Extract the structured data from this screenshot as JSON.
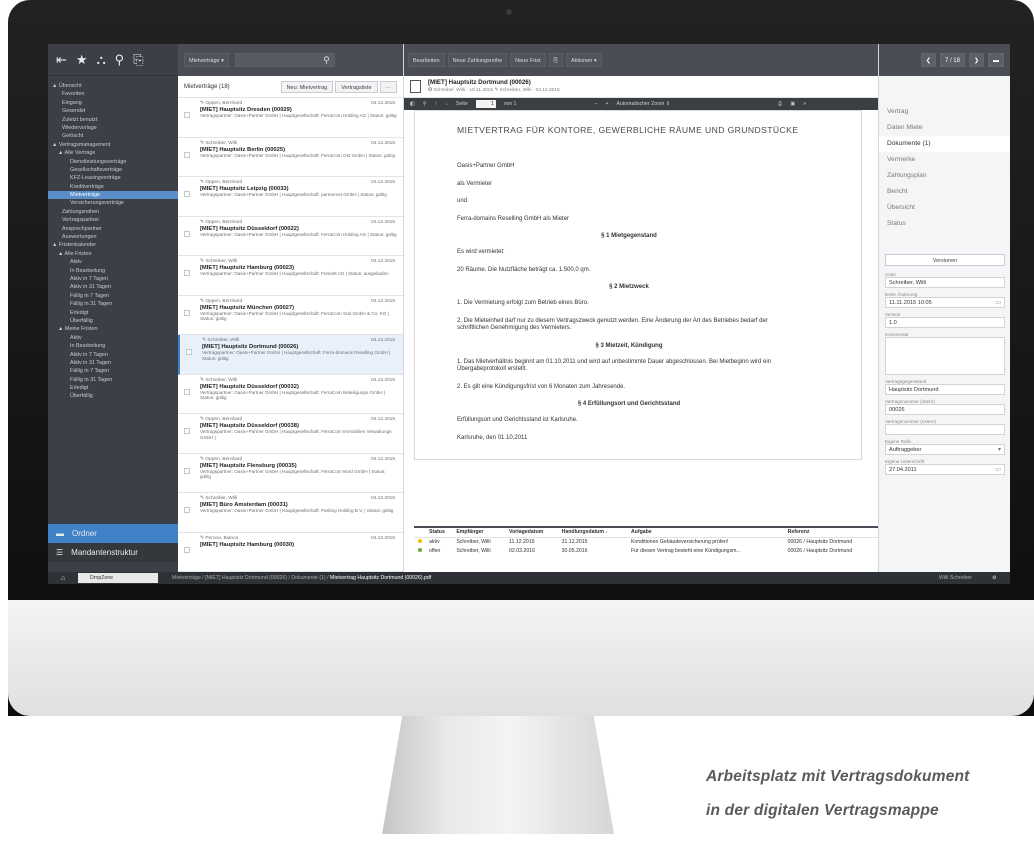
{
  "nav": {
    "tree": [
      "▲ Übersicht",
      "Favoriten",
      "Eingang",
      "Gesendet",
      "Zuletzt benutzt",
      "Wiedervorlage",
      "Gelöscht",
      "▲ Vertragsmanagement",
      "▲ Alle Verträge",
      "Dienstleistungsverträge",
      "Gesellschaftsverträge",
      "KFZ-Leasingverträge",
      "Kreditverträge",
      "Mietverträge",
      "Versicherungsverträge",
      "Zahlungsreihen",
      "Vertragspartner",
      "Ansprechpartner",
      "Auswertungen",
      "▲ Fristenkalender",
      "▲ Alle Fristen",
      "Aktiv",
      "In Bearbeitung",
      "Aktiv in 7 Tagen",
      "Aktiv in 31 Tagen",
      "Fällig in 7 Tagen",
      "Fällig in 31 Tagen",
      "Erledigt",
      "Überfällig",
      "▲ Meine Fristen",
      "Aktiv",
      "In Bearbeitung",
      "Aktiv in 7 Tagen",
      "Aktiv in 31 Tagen",
      "Fällig in 7 Tagen",
      "Fällig in 31 Tagen",
      "Erledigt",
      "Überfällig"
    ],
    "selected_index": 13,
    "ordner": "Ordner",
    "mandant": "Mandantenstruktur"
  },
  "list": {
    "dropdown": "Mietverträge ▾",
    "title": "Mietverträge (18)",
    "new_btn": "Neu: Mietvertrag",
    "list_btn": "Vertragsliste",
    "more_btn": "···",
    "items": [
      {
        "author": "✎ Oppen, Bernhard",
        "date": "04.12.2015",
        "title": "[MIET] Hauptsitz Dresden (00029)",
        "desc": "Vertragspartner: Oasis+Partner GmbH | Hauptgesellschaft: FerraCom Holding AG | Status: gültig"
      },
      {
        "author": "✎ Schreiber, Willi",
        "date": "04.12.2015",
        "title": "[MIET] Hauptsitz Berlin (00025)",
        "desc": "Vertragspartner: Oasis+Partner GmbH | Hauptgesellschaft: FerraCom Ost GmbH | Status: gültig"
      },
      {
        "author": "✎ Oppen, Bernhard",
        "date": "04.12.2015",
        "title": "[MIET] Hauptsitz Leipzig (00033)",
        "desc": "Vertragspartner: Oasis+Partner GmbH | Hauptgesellschaft: partnernet GmbH | Status: gültig"
      },
      {
        "author": "✎ Oppen, Bernhard",
        "date": "04.12.2015",
        "title": "[MIET] Hauptsitz Düsseldorf (00022)",
        "desc": "Vertragspartner: Oasis+Partner GmbH | Hauptgesellschaft: FerraCom Holding AG | Status: gültig"
      },
      {
        "author": "✎ Schreiber, Willi",
        "date": "04.12.2015",
        "title": "[MIET] Hauptsitz Hamburg (00023)",
        "desc": "Vertragspartner: Oasis+Partner GmbH | Hauptgesellschaft: Freinett AG | Status: ausgelaufen"
      },
      {
        "author": "✎ Oppen, Bernhard",
        "date": "04.12.2015",
        "title": "[MIET] Hauptsitz München (00027)",
        "desc": "Vertragspartner: Oasis+Partner GmbH | Hauptgesellschaft: FerraCom Süd GmbH & Co. KG | Status: gültig"
      },
      {
        "author": "✎ Schreiber, Willi",
        "date": "04.12.2015",
        "title": "[MIET] Hauptsitz Dortmund (00026)",
        "desc": "Vertragspartner: Oasis+Partner GmbH | Hauptgesellschaft: Ferra-domains Reselling GmbH | Status: gültig"
      },
      {
        "author": "✎ Schreiber, Willi",
        "date": "04.12.2015",
        "title": "[MIET] Hauptsitz Düsseldorf (00032)",
        "desc": "Vertragspartner: Oasis+Partner GmbH | Hauptgesellschaft: FerraCom Beteiligungs GmbH | Status: gültig"
      },
      {
        "author": "✎ Oppen, Bernhard",
        "date": "04.12.2015",
        "title": "[MIET] Hauptsitz Düsseldorf (00038)",
        "desc": "Vertragspartner: Oasis+Partner GmbH | Hauptgesellschaft: FerraCom Immobilien Verwaltungs GmbH |"
      },
      {
        "author": "✎ Oppen, Bernhard",
        "date": "04.12.2015",
        "title": "[MIET] Hauptsitz Flensburg (00035)",
        "desc": "Vertragspartner: Oasis+Partner GmbH | Hauptgesellschaft: FerraCom Nord GmbH | Status: gültig"
      },
      {
        "author": "✎ Schreiber, Willi",
        "date": "04.12.2015",
        "title": "[MIET] Büro Amsterdam (00031)",
        "desc": "Vertragspartner: Oasis+Partner GmbH | Hauptgesellschaft: Parking Holding B.V. | Status: gültig"
      },
      {
        "author": "✎ Perona, Bianca",
        "date": "04.12.2015",
        "title": "[MIET] Hauptsitz Hamburg (00030)",
        "desc": ""
      }
    ],
    "highlighted_index": 6
  },
  "doc": {
    "toolbar": [
      "Bearbeiten",
      "Neue Zahlungsreihe",
      "Neue Frist",
      "⎘",
      "Aktionen ▾"
    ],
    "title": "[MIET] Hauptsitz Dortmund (00026)",
    "meta": "✪ Schreiber, Willi · 10.11.2015   ✎ Schreiber, Willi · 04.12.2015",
    "pdf_seite": "Seite",
    "pdf_page": "1",
    "pdf_of": "von 1",
    "pdf_zoom": "Automatischer Zoom ⇕",
    "page": {
      "heading": "MIETVERTRAG FÜR KONTORE, GEWERBLICHE RÄUME UND GRUNDSTÜCKE",
      "p1": "Oasis+Partner GmbH",
      "p2": "als Vermieter",
      "p3": "und",
      "p4": "Ferra-domains Reselling GmbH als Mieter",
      "s1": "§ 1 Mietgegenstand",
      "p5": "Es wird vermietet:",
      "p6": "20 Räume. Die Nutzfläche beträgt ca. 1.500,0 qm.",
      "s2": "§ 2 Mietzweck",
      "p7": "1. Die Vermietung erfolgt zum Betrieb eines Büro.",
      "p8": "2. Die Mieteinheit darf nur zu diesem Vertragszweck genutzt werden. Eine Änderung der Art des Betriebes bedarf der schriftlichen Genehmigung des Vermieters.",
      "s3": "§ 3 Mietzeit, Kündigung",
      "p9": "1. Das Mietverhältnis beginnt am 01.10.2011 und wird auf unbestimmte Dauer abgeschlossen. Bei Mietbeginn wird ein Übergabeprotokoll erstellt.",
      "p10": "2. Es gilt eine Kündigungsfrist von 6 Monaten zum Jahresende.",
      "s4": "§ 4 Erfüllungsort und Gerichtsstand",
      "p11": "Erfüllungsort und Gerichtsstand ist Karlsruhe.",
      "p12": "Karlsruhe, den 01.10.2011"
    },
    "tasks": {
      "headers": [
        "Status",
        "Empfänger",
        "Vorlagedatum",
        "Handlungsdatum ↓",
        "Aufgabe",
        "Referenz"
      ],
      "rows": [
        [
          "aktiv",
          "Schreiber, Willi",
          "11.12.2015",
          "31.12.2015",
          "Konditionen Gebäudeversicherung prüfen!",
          "00026 / Hauptsitz Dortmund"
        ],
        [
          "offen",
          "Schreiber, Willi",
          "02.03.2016",
          "30.05.2016",
          "Für diesen Vertrag besteht eine Kündigungsm...",
          "00026 / Hauptsitz Dortmund"
        ]
      ]
    }
  },
  "right": {
    "pager": "7 / 18",
    "nav": [
      "Vertrag",
      "Daten Miete",
      "Dokumente (1)",
      "Vermerke",
      "Zahlungsplan",
      "Bericht",
      "Übersicht",
      "Status"
    ],
    "active_index": 2,
    "versionen": "Versionen",
    "autor_label": "Autor",
    "autor": "Schreiber, Willi",
    "aend_label": "letzte Änderung",
    "aend": "11.11.2015 10:05",
    "version_label": "Version",
    "version": "1.0",
    "kommentar_label": "Kommentar",
    "vg_label": "Vertragsgegenstand",
    "vg": "Hauptsitz Dortmund",
    "vn_int_label": "Vertragsnummer (intern)",
    "vn_int": "00026",
    "vn_ext_label": "Vertragsnummer (extern)",
    "rolle_label": "Eigene Rolle",
    "rolle": "Auftraggeber",
    "unterschrift_label": "Eigene Unterschrift",
    "unterschrift": "27.04.2011"
  },
  "status": {
    "dropzone": "DropZone",
    "path_plain": "Mietverträge  /  [MIET] Hauptsitz Dortmund (00026)  /  Dokumente (1)  /  ",
    "path_strong": "Mietvertrag Hauptsitz Dortmund (00026).pdf",
    "user": "Willi Schreiber"
  },
  "caption": {
    "line1": "Arbeitsplatz mit Vertragsdokument",
    "line2": "in der digitalen Vertragsmappe"
  }
}
